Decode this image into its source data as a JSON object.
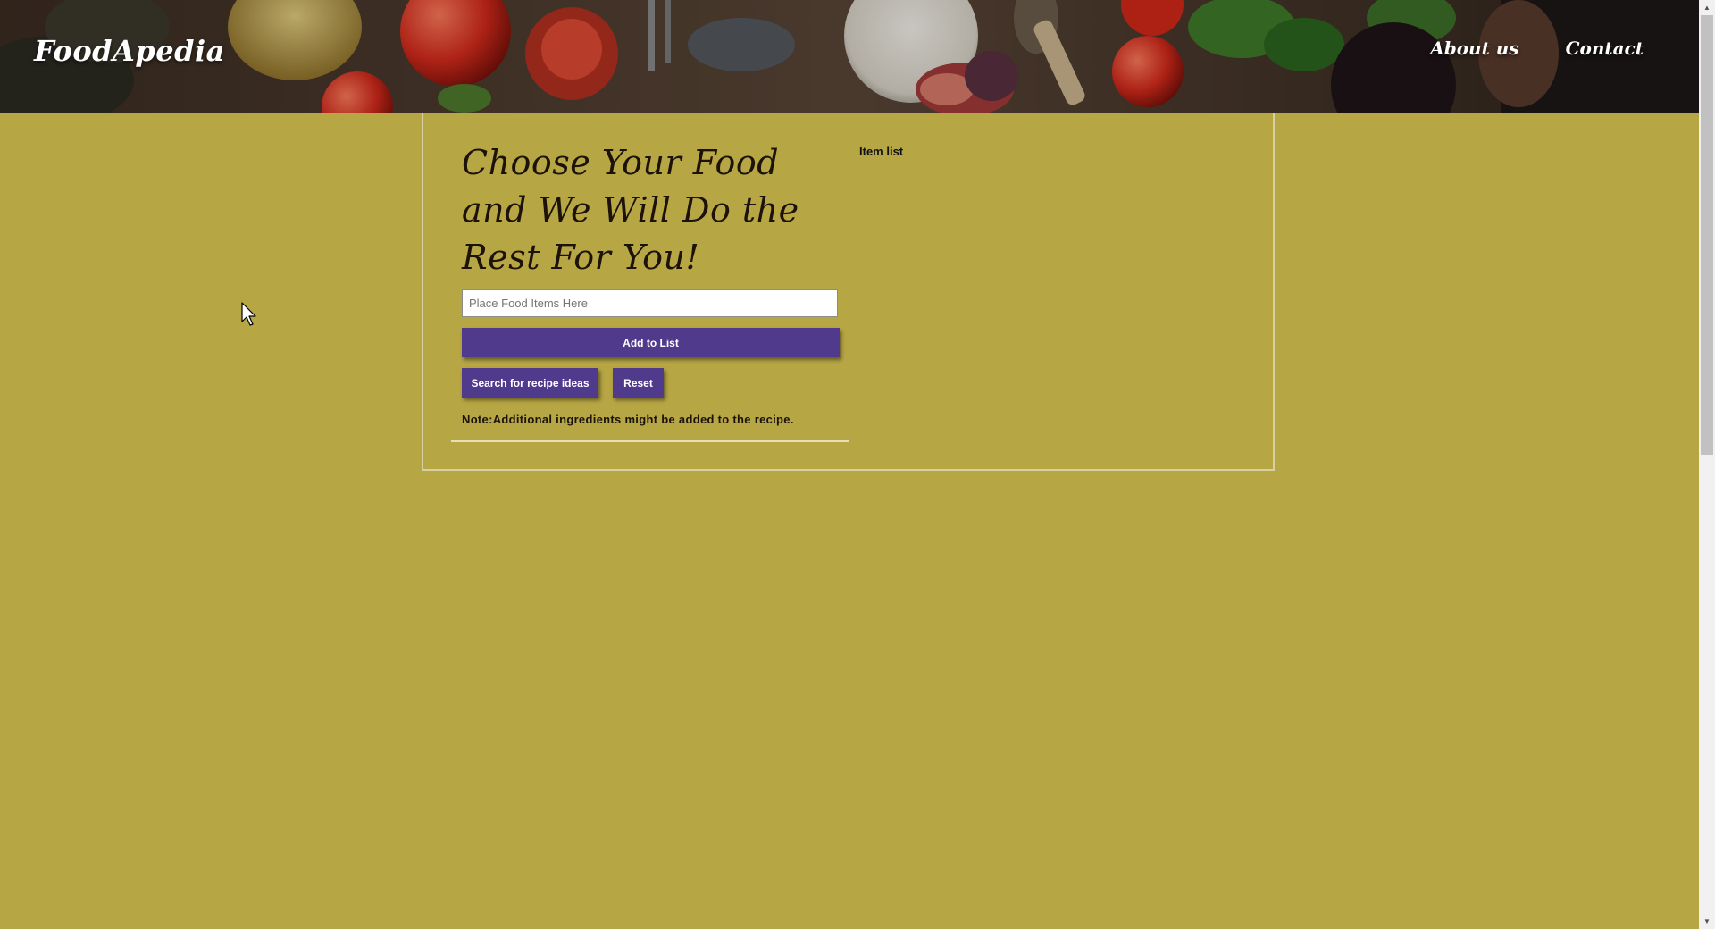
{
  "header": {
    "brand": "FoodApedia",
    "nav": [
      {
        "label": "About us"
      },
      {
        "label": "Contact"
      }
    ]
  },
  "main": {
    "headline": "Choose Your Food and We Will Do the Rest For You!",
    "food_input": {
      "value": "",
      "placeholder": "Place Food Items Here"
    },
    "add_button": "Add to List",
    "search_button": "Search for recipe ideas",
    "reset_button": "Reset",
    "note": "Note:Additional ingredients might be added to the recipe.",
    "item_list_label": "Item list"
  },
  "colors": {
    "background": "#b7a644",
    "button": "#4f3a8c",
    "panel_border": "#d9d0a2"
  }
}
